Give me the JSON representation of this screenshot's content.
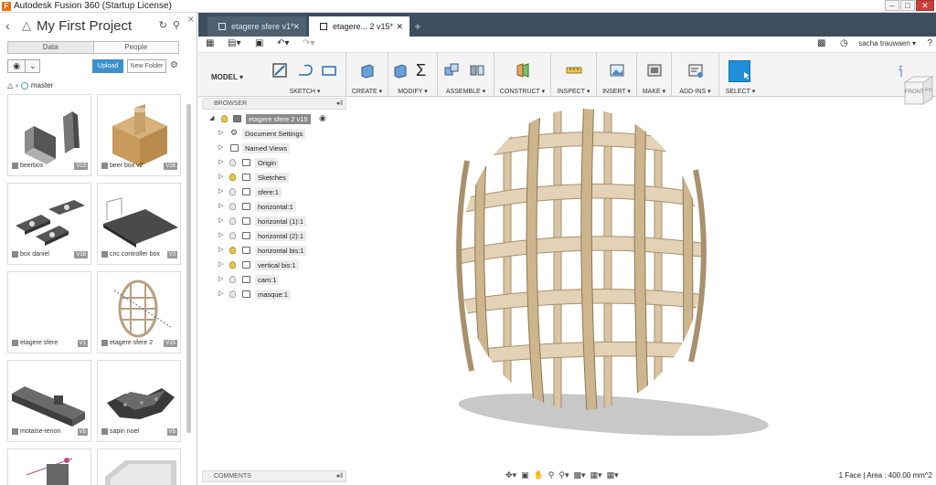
{
  "window": {
    "title": "Autodesk Fusion 360 (Startup License)"
  },
  "data_panel": {
    "project_title": "My First Project",
    "tabs": [
      {
        "label": "Data"
      },
      {
        "label": "People"
      }
    ],
    "upload_label": "Upload",
    "new_folder_label": "New Folder",
    "branch": "master",
    "items": [
      {
        "name": "beerbox",
        "version": "V13"
      },
      {
        "name": "beer box v2",
        "version": "V26"
      },
      {
        "name": "box daniel",
        "version": "V16"
      },
      {
        "name": "cnc controller box",
        "version": "V3"
      },
      {
        "name": "etagere sfere",
        "version": "V1"
      },
      {
        "name": "etagere sfere 2",
        "version": "V15"
      },
      {
        "name": "motaise-tenon",
        "version": "V5"
      },
      {
        "name": "sapin noel",
        "version": "V5"
      }
    ]
  },
  "doc_tabs": [
    {
      "label": "etagere sfere v1*"
    },
    {
      "label": "etagere... 2 v15*"
    }
  ],
  "user": {
    "name": "sacha trauwaen ▾"
  },
  "toolbar": {
    "workspace": "MODEL ▾",
    "groups": [
      {
        "label": "SKETCH ▾"
      },
      {
        "label": "CREATE ▾"
      },
      {
        "label": "MODIFY ▾"
      },
      {
        "label": "ASSEMBLE ▾"
      },
      {
        "label": "CONSTRUCT ▾"
      },
      {
        "label": "INSPECT ▾"
      },
      {
        "label": "INSERT ▾"
      },
      {
        "label": "MAKE ▾"
      },
      {
        "label": "ADD-INS ▾"
      },
      {
        "label": "SELECT ▾"
      }
    ]
  },
  "viewcube": {
    "front": "FRONT",
    "right": "RIGHT",
    "axis_z": "Z"
  },
  "browser": {
    "header": "BROWSER",
    "root": "etagere sfere 2 v15",
    "nodes": [
      {
        "label": "Document Settings",
        "icon": "gear-icon"
      },
      {
        "label": "Named Views",
        "icon": "folder-icon"
      },
      {
        "label": "Origin",
        "icon": "folder-icon"
      },
      {
        "label": "Sketches",
        "icon": "folder-icon"
      },
      {
        "label": "sfere:1",
        "icon": "component-icon"
      },
      {
        "label": "horizontal:1",
        "icon": "component-icon"
      },
      {
        "label": "horizontal (1):1",
        "icon": "component-icon"
      },
      {
        "label": "horizontal (2):1",
        "icon": "component-icon"
      },
      {
        "label": "horizontal bis:1",
        "icon": "component-icon"
      },
      {
        "label": "vertical bis:1",
        "icon": "component-icon"
      },
      {
        "label": "cam:1",
        "icon": "component-icon"
      },
      {
        "label": "masque:1",
        "icon": "component-icon"
      }
    ]
  },
  "comments": {
    "header": "COMMENTS"
  },
  "status": {
    "selection": "1 Face | Area : 400.00 mm^2"
  }
}
